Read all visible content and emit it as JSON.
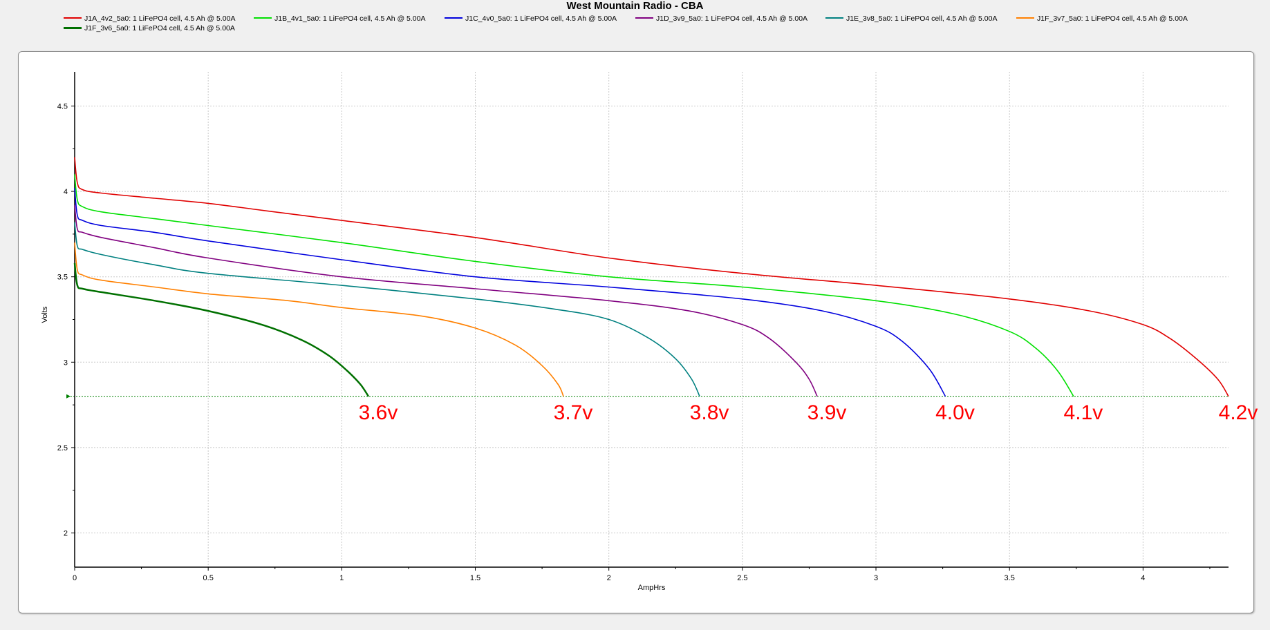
{
  "chart_data": {
    "type": "line",
    "title": "West Mountain Radio - CBA",
    "xlabel": "AmpHrs",
    "ylabel": "Volts",
    "xlim": [
      0,
      4.32
    ],
    "ylim": [
      1.8,
      4.7
    ],
    "xticks": [
      "0",
      "0.5",
      "1",
      "1.5",
      "2",
      "2.5",
      "3",
      "3.5",
      "4"
    ],
    "yticks": [
      "2",
      "2.5",
      "3",
      "3.5",
      "4",
      "4.5"
    ],
    "grid": true,
    "legend_position": "top",
    "cutoff_voltage": 2.8,
    "series": [
      {
        "name": "J1A_4v2_5a0: 1 LiFePO4 cell, 4.5 Ah @ 5.00A",
        "color": "#e00000",
        "x": [
          0,
          0.01,
          0.03,
          0.1,
          0.3,
          0.5,
          0.7,
          1.0,
          1.5,
          2.0,
          2.5,
          3.0,
          3.5,
          3.8,
          4.0,
          4.1,
          4.2,
          4.28,
          4.32
        ],
        "y": [
          4.2,
          4.05,
          4.01,
          3.99,
          3.96,
          3.93,
          3.89,
          3.83,
          3.73,
          3.61,
          3.52,
          3.45,
          3.37,
          3.3,
          3.22,
          3.14,
          3.02,
          2.9,
          2.8
        ]
      },
      {
        "name": "J1B_4v1_5a0: 1 LiFePO4 cell, 4.5 Ah @ 5.00A",
        "color": "#00e000",
        "x": [
          0,
          0.01,
          0.03,
          0.1,
          0.3,
          0.5,
          1.0,
          1.5,
          2.0,
          2.5,
          3.0,
          3.3,
          3.5,
          3.6,
          3.68,
          3.74
        ],
        "y": [
          4.1,
          3.95,
          3.91,
          3.88,
          3.84,
          3.8,
          3.7,
          3.59,
          3.5,
          3.44,
          3.36,
          3.28,
          3.18,
          3.08,
          2.95,
          2.8
        ]
      },
      {
        "name": "J1C_4v0_5a0: 1 LiFePO4 cell, 4.5 Ah @ 5.00A",
        "color": "#0000dd",
        "x": [
          0,
          0.01,
          0.03,
          0.1,
          0.3,
          0.5,
          1.0,
          1.5,
          2.0,
          2.5,
          2.8,
          3.0,
          3.1,
          3.2,
          3.26
        ],
        "y": [
          4.02,
          3.86,
          3.83,
          3.8,
          3.76,
          3.71,
          3.6,
          3.5,
          3.44,
          3.37,
          3.3,
          3.21,
          3.12,
          2.96,
          2.8
        ]
      },
      {
        "name": "J1D_3v9_5a0: 1 LiFePO4 cell, 4.5 Ah @ 5.00A",
        "color": "#800080",
        "x": [
          0,
          0.01,
          0.03,
          0.1,
          0.3,
          0.5,
          1.0,
          1.5,
          2.0,
          2.3,
          2.5,
          2.6,
          2.7,
          2.75,
          2.78
        ],
        "y": [
          3.92,
          3.78,
          3.76,
          3.73,
          3.67,
          3.61,
          3.5,
          3.43,
          3.36,
          3.3,
          3.22,
          3.14,
          3.0,
          2.9,
          2.8
        ]
      },
      {
        "name": "J1E_3v8_5a0: 1 LiFePO4 cell, 4.5 Ah @ 5.00A",
        "color": "#008080",
        "x": [
          0,
          0.01,
          0.03,
          0.1,
          0.3,
          0.5,
          1.0,
          1.5,
          1.8,
          2.0,
          2.15,
          2.25,
          2.31,
          2.34
        ],
        "y": [
          3.82,
          3.68,
          3.66,
          3.63,
          3.57,
          3.52,
          3.45,
          3.37,
          3.31,
          3.25,
          3.14,
          3.02,
          2.9,
          2.8
        ]
      },
      {
        "name": "J1F_3v7_5a0: 1 LiFePO4 cell, 4.5 Ah @ 5.00A",
        "color": "#ff8000",
        "x": [
          0,
          0.01,
          0.03,
          0.1,
          0.3,
          0.5,
          0.8,
          1.0,
          1.3,
          1.5,
          1.65,
          1.75,
          1.81,
          1.83
        ],
        "y": [
          3.7,
          3.54,
          3.51,
          3.48,
          3.44,
          3.4,
          3.36,
          3.32,
          3.27,
          3.2,
          3.1,
          2.98,
          2.87,
          2.8
        ]
      },
      {
        "name": "J1F_3v6_5a0: 1 LiFePO4 cell, 4.5 Ah @ 5.00A",
        "color": "#007000",
        "x": [
          0,
          0.01,
          0.03,
          0.1,
          0.3,
          0.5,
          0.7,
          0.85,
          0.95,
          1.02,
          1.07,
          1.1
        ],
        "y": [
          3.58,
          3.45,
          3.43,
          3.41,
          3.36,
          3.3,
          3.22,
          3.13,
          3.04,
          2.95,
          2.87,
          2.8
        ]
      }
    ],
    "annotations": [
      {
        "text": "3.6v",
        "x": 1.1
      },
      {
        "text": "3.7v",
        "x": 1.83
      },
      {
        "text": "3.8v",
        "x": 2.34
      },
      {
        "text": "3.9v",
        "x": 2.78
      },
      {
        "text": "4.0v",
        "x": 3.26
      },
      {
        "text": "4.1v",
        "x": 3.74
      },
      {
        "text": "4.2v",
        "x": 4.32
      }
    ]
  }
}
